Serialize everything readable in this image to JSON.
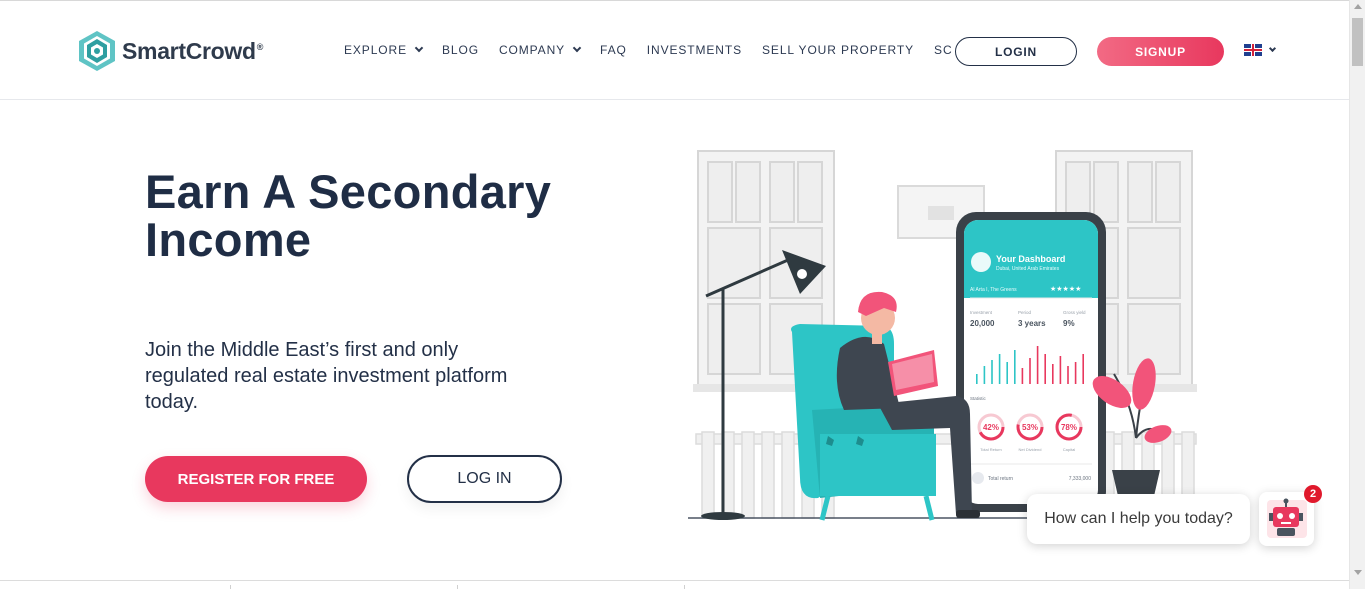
{
  "brand": {
    "name": "SmartCrowd",
    "reg": "®",
    "accent": "#e8385e",
    "dark": "#233047",
    "teal": "#2dc5c6"
  },
  "nav": {
    "items": [
      {
        "label": "EXPLORE",
        "dropdown": true
      },
      {
        "label": "BLOG",
        "dropdown": false
      },
      {
        "label": "COMPANY",
        "dropdown": true
      },
      {
        "label": "FAQ",
        "dropdown": false
      },
      {
        "label": "INVESTMENTS",
        "dropdown": false
      },
      {
        "label": "SELL YOUR PROPERTY",
        "dropdown": false
      },
      {
        "label": "SC PLUS",
        "dropdown": false
      }
    ],
    "login_label": "LOGIN",
    "signup_label": "SIGNUP",
    "language_icon": "uk-flag-icon"
  },
  "hero": {
    "title": "Earn A Secondary Income",
    "subtitle": "Join the Middle East’s first and only regulated real estate investment platform today.",
    "register_label": "REGISTER FOR FREE",
    "login_label": "LOG IN"
  },
  "phone": {
    "dashboard_title": "Your Dashboard",
    "location": "Dubai, United Arab Emirates",
    "property": "Al Arta I, The Greens",
    "stats": [
      {
        "label": "Investment",
        "value": "20,000"
      },
      {
        "label": "Period",
        "value": "3 years"
      },
      {
        "label": "Gross yield",
        "value": "9%"
      }
    ],
    "statistics_label": "Statistic",
    "gauges": [
      {
        "value": "42%",
        "label": "Total Return"
      },
      {
        "value": "53%",
        "label": "Net Dividend"
      },
      {
        "value": "78%",
        "label": "Capital"
      }
    ],
    "total_return_label": "Total return",
    "total_return_value": "7,333,000"
  },
  "chat": {
    "prompt": "How can I help you today?",
    "badge_count": "2"
  }
}
